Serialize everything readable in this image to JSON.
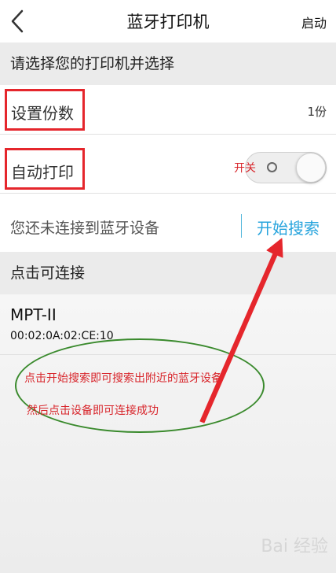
{
  "header": {
    "title": "蓝牙打印机",
    "start_label": "启动"
  },
  "section1": {
    "title": "请选择您的打印机并选择"
  },
  "copies": {
    "label": "设置份数",
    "value": "1份"
  },
  "auto_print": {
    "label": "自动打印",
    "toggle_text": "开关",
    "state": "off"
  },
  "connection": {
    "status": "您还未连接到蓝牙设备",
    "search_label": "开始搜索"
  },
  "section2": {
    "title": "点击可连接"
  },
  "devices": [
    {
      "name": "MPT-II",
      "mac": "00:02:0A:02:CE:10"
    }
  ],
  "annotations": [
    "点击开始搜索即可搜索出附近的蓝牙设备",
    "然后点击设备即可连接成功"
  ],
  "watermark": "Bai 经验",
  "colors": {
    "accent": "#27a4dd",
    "annotation_red": "#d8252b",
    "ellipse_green": "#3a8a2d"
  },
  "icons": {
    "back": "chevron-left-icon"
  }
}
